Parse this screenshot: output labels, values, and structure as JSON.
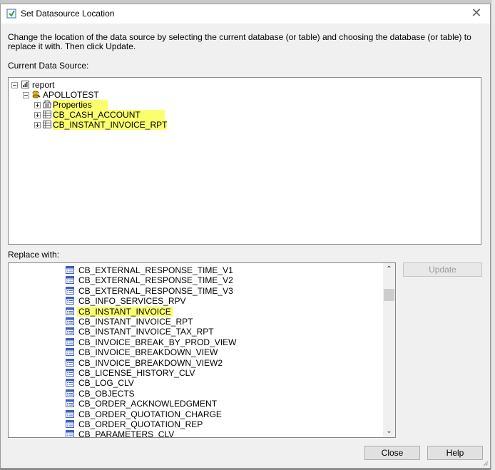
{
  "window": {
    "title": "Set Datasource Location",
    "close_symbol": "✕"
  },
  "instructions": "Change the location of the data source by selecting the current database (or table) and choosing the database (or table) to replace it with. Then click Update.",
  "current_label": "Current Data Source:",
  "replace_label": "Replace with:",
  "current_tree": {
    "root": "report",
    "connection": "APOLLOTEST",
    "properties": "Properties",
    "tables": [
      {
        "label": "CB_CASH_ACCOUNT",
        "highlighted": true
      },
      {
        "label": "CB_INSTANT_INVOICE_RPT",
        "highlighted": true
      }
    ]
  },
  "replace_list": {
    "items": [
      "CB_EXTERNAL_RESPONSE_TIME_V1",
      "CB_EXTERNAL_RESPONSE_TIME_V2",
      "CB_EXTERNAL_RESPONSE_TIME_V3",
      "CB_INFO_SERVICES_RPV",
      "CB_INSTANT_INVOICE",
      "CB_INSTANT_INVOICE_RPT",
      "CB_INSTANT_INVOICE_TAX_RPT",
      "CB_INVOICE_BREAK_BY_PROD_VIEW",
      "CB_INVOICE_BREAKDOWN_VIEW",
      "CB_INVOICE_BREAKDOWN_VIEW2",
      "CB_LICENSE_HISTORY_CLV",
      "CB_LOG_CLV",
      "CB_OBJECTS",
      "CB_ORDER_ACKNOWLEDGMENT",
      "CB_ORDER_QUOTATION_CHARGE",
      "CB_ORDER_QUOTATION_REP",
      "CB_PARAMETERS_CLV"
    ],
    "highlighted_item": "CB_INSTANT_INVOICE"
  },
  "buttons": {
    "update": "Update",
    "close": "Close",
    "help": "Help"
  },
  "colors": {
    "highlight": "#fbff6e",
    "table_icon": "#3a5fbf"
  }
}
